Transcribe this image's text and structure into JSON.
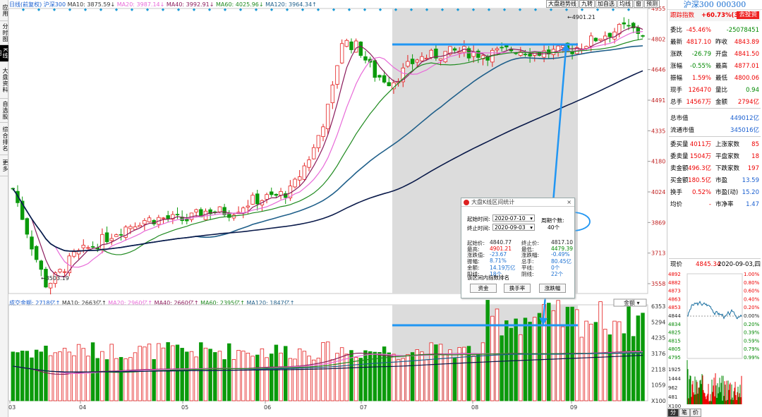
{
  "left_tabs": [
    {
      "label": "应用",
      "active": false
    },
    {
      "label": "分时图",
      "active": false
    },
    {
      "label": "K线图",
      "active": true
    },
    {
      "label": "大盘资料",
      "active": false
    },
    {
      "label": "自选股",
      "active": false
    },
    {
      "label": "综合排名",
      "active": false
    },
    {
      "label": "更多",
      "active": false
    }
  ],
  "ma_info": {
    "period": "日线(前复权)",
    "name": "沪深300",
    "ma10": "MA10: 3875.59↓",
    "ma20": "MA20: 3987.14↓",
    "ma40": "MA40: 3992.91↓",
    "ma60": "MA60: 4025.96↓",
    "ma120": "MA120: 3964.34↑"
  },
  "vol_info": {
    "amount": "成交金额: 2718亿↑",
    "ma10": "MA10: 2663亿↑",
    "ma20": "MA20: 2960亿↑",
    "ma40": "MA40: 2660亿↑",
    "ma60": "MA60: 2395亿↑",
    "ma120": "MA120: 1847亿↑"
  },
  "top_buttons": [
    "大盘趋势线",
    "九转",
    "加自选",
    "均线",
    "窗",
    "预测"
  ],
  "price_axis": [
    "4955",
    "4802",
    "4646",
    "4491",
    "4335",
    "4180",
    "4024",
    "3869",
    "3713",
    "3558"
  ],
  "vol_axis": [
    "6353",
    "5294",
    "4235",
    "3176",
    "2118",
    "1059",
    "X100"
  ],
  "month_labels": [
    "03",
    "04",
    "05",
    "06",
    "07",
    "08",
    "09"
  ],
  "high_label": "4901.21",
  "low_label": "3503.19",
  "vol_dropdown": "金额",
  "colors": {
    "up": "#e41f1f",
    "down": "#0b9a0b",
    "ma10": "#2a2a2a",
    "ma20": "#e86ad8",
    "ma40": "#8b1b5c",
    "ma60": "#1f8a1f",
    "ma120": "#1f5f8a",
    "ma250": "#0a1a4a",
    "arrow": "#2196f3",
    "selection": "#dcdcdc"
  },
  "stats_dialog": {
    "title": "大盘K线区间统计",
    "start_label": "起始时间:",
    "start_value": "2020-07-10",
    "end_label": "终止时间:",
    "end_value": "2020-09-03",
    "period_label": "周期个数:",
    "period_value": "40个",
    "rows": [
      {
        "l1": "起始价:",
        "v1": "4840.77",
        "l2": "终止价:",
        "v2": "4817.10"
      },
      {
        "l1": "最高:",
        "v1": "4901.21",
        "l2": "最低:",
        "v2": "4479.39"
      },
      {
        "l1": "涨跌值:",
        "v1": "-23.67",
        "l2": "涨跌幅:",
        "v2": "-0.49%"
      },
      {
        "l1": "振幅:",
        "v1": "8.71%",
        "l2": "总手:",
        "v2": "80.45亿"
      },
      {
        "l1": "金额:",
        "v1": "14.19万亿",
        "l2": "平线:",
        "v2": "0个"
      },
      {
        "l1": "阳线:",
        "v1": "18个",
        "l2": "阴线:",
        "v2": "22个"
      }
    ],
    "ranking_label": "该区间内指数排名",
    "buttons": [
      "资金",
      "换手率",
      "涨跌幅"
    ]
  },
  "right_panel": {
    "title": "沪深300 000300",
    "header_left": "跟踪指数",
    "header_mid": "+60.73%(3年)",
    "header_btn": "去投资",
    "rows": [
      {
        "a": "委比",
        "b": "-45.46%",
        "c": "",
        "d": "-25078451"
      },
      {
        "a": "最新",
        "b": "4817.10",
        "c": "昨收",
        "d": "4843.89"
      },
      {
        "a": "涨跌",
        "b": "-26.79",
        "c": "开盘",
        "d": "4841.50"
      },
      {
        "a": "涨幅",
        "b": "-0.55%",
        "c": "最高",
        "d": "4877.01"
      },
      {
        "a": "振幅",
        "b": "1.59%",
        "c": "最低",
        "d": "4800.06"
      },
      {
        "a": "现手",
        "b": "126470",
        "c": "量比",
        "d": "0.94"
      },
      {
        "a": "总手",
        "b": "14567万",
        "c": "金额",
        "d": "2794亿"
      },
      {
        "a": "总市值",
        "b": "",
        "c": "",
        "d": "449012亿"
      },
      {
        "a": "流通市值",
        "b": "",
        "c": "",
        "d": "345016亿"
      },
      {
        "a": "委买量",
        "b": "4011万",
        "c": "上涨家数",
        "d": "85"
      },
      {
        "a": "委卖量",
        "b": "1504万",
        "c": "平盘家数",
        "d": "18"
      },
      {
        "a": "卖金额",
        "b": "496.3亿",
        "c": "下跌家数",
        "d": "197"
      },
      {
        "a": "买金额",
        "b": "180.5亿",
        "c": "市盈",
        "d": "13.59"
      },
      {
        "a": "换手",
        "b": "0.52%",
        "c": "市盈(动)",
        "d": "15.20"
      },
      {
        "a": "均价",
        "b": "-",
        "c": "市净率",
        "d": "1.47"
      }
    ],
    "now_label": "现价",
    "now_value": "4845.34",
    "now_date": "2020-09-03,四",
    "mini_price_axis": [
      "4892",
      "4882",
      "4873",
      "4863",
      "4853",
      "4844",
      "4834",
      "4825",
      "4815",
      "4805",
      "4795"
    ],
    "mini_pct_axis": [
      "1.00%",
      "0.80%",
      "0.60%",
      "0.40%",
      "0.20%",
      "0.00%",
      "0.20%",
      "0.39%",
      "0.59%",
      "0.79%",
      "0.99%"
    ],
    "mini_vol_axis": [
      "1925",
      "1444",
      "962",
      "481",
      "X100"
    ],
    "mini_tabs": [
      "分",
      "笔",
      "价"
    ]
  }
}
